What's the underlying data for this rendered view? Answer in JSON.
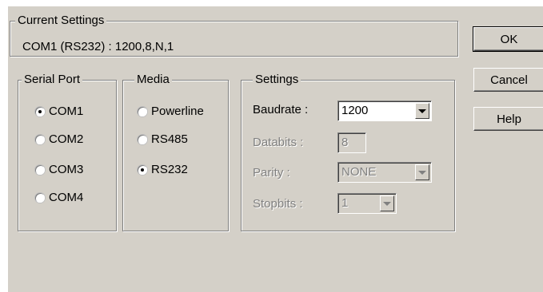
{
  "current_settings": {
    "legend": "Current Settings",
    "value": "COM1 (RS232) : 1200,8,N,1"
  },
  "serial_port": {
    "legend": "Serial Port",
    "options": [
      {
        "label": "COM1",
        "selected": true
      },
      {
        "label": "COM2",
        "selected": false
      },
      {
        "label": "COM3",
        "selected": false
      },
      {
        "label": "COM4",
        "selected": false
      }
    ]
  },
  "media": {
    "legend": "Media",
    "options": [
      {
        "label": "Powerline",
        "selected": false
      },
      {
        "label": "RS485",
        "selected": false
      },
      {
        "label": "RS232",
        "selected": true
      }
    ]
  },
  "settings": {
    "legend": "Settings",
    "baudrate": {
      "label": "Baudrate :",
      "value": "1200",
      "enabled": true
    },
    "databits": {
      "label": "Databits :",
      "value": "8",
      "enabled": false
    },
    "parity": {
      "label": "Parity :",
      "value": "NONE",
      "enabled": false
    },
    "stopbits": {
      "label": "Stopbits :",
      "value": "1",
      "enabled": false
    }
  },
  "buttons": {
    "ok": "OK",
    "cancel": "Cancel",
    "help": "Help"
  },
  "colors": {
    "dialog_bg": "#d4d0c8",
    "disabled_text": "#808080"
  }
}
